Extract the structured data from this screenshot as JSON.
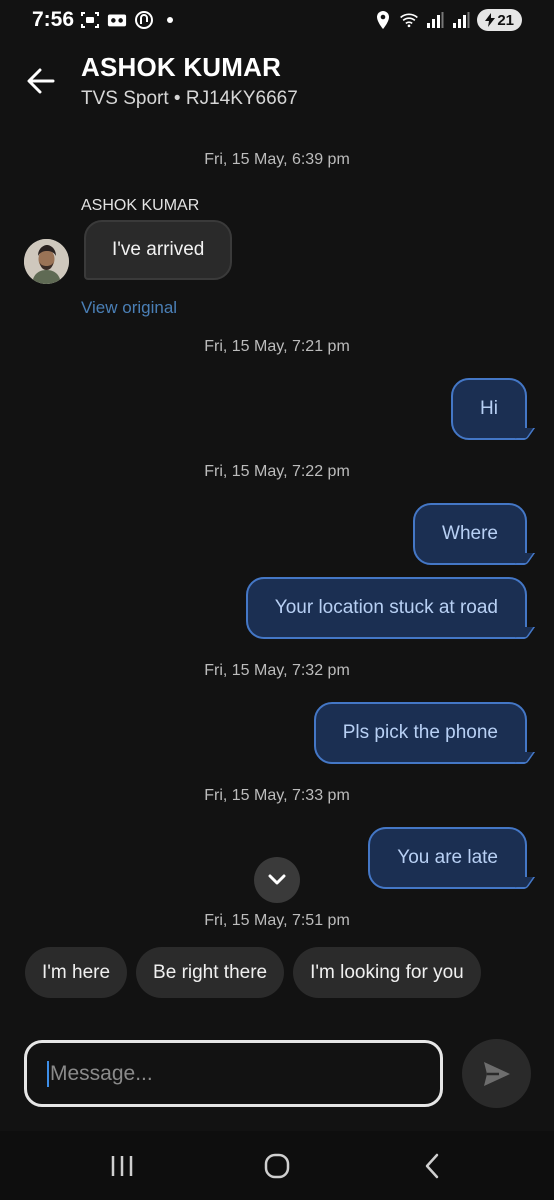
{
  "status_bar": {
    "time": "7:56",
    "battery": "21",
    "icons_left": [
      "screenshot-icon",
      "voicemail-icon",
      "app-icon",
      "dot-icon"
    ],
    "icons_right": [
      "location-icon",
      "wifi-icon",
      "signal-icon",
      "signal-icon",
      "battery-icon"
    ]
  },
  "header": {
    "name": "ASHOK KUMAR",
    "vehicle": "TVS Sport • RJ14KY6667"
  },
  "messages": [
    {
      "type": "stamp",
      "text": "Fri, 15 May, 6:39 pm"
    },
    {
      "type": "incoming",
      "sender": "ASHOK KUMAR",
      "text": "I've arrived",
      "link": "View original"
    },
    {
      "type": "stamp",
      "text": "Fri, 15 May, 7:21 pm"
    },
    {
      "type": "outgoing",
      "text": "Hi"
    },
    {
      "type": "stamp",
      "text": "Fri, 15 May, 7:22 pm"
    },
    {
      "type": "outgoing",
      "text": "Where"
    },
    {
      "type": "outgoing",
      "text": "Your location stuck at road"
    },
    {
      "type": "stamp",
      "text": "Fri, 15 May, 7:32 pm"
    },
    {
      "type": "outgoing",
      "text": "Pls pick the phone"
    },
    {
      "type": "stamp",
      "text": "Fri, 15 May, 7:33 pm"
    },
    {
      "type": "outgoing",
      "text": "You are late"
    },
    {
      "type": "stamp",
      "text": "Fri, 15 May, 7:51 pm"
    }
  ],
  "quick_replies": [
    "I'm here",
    "Be right there",
    "I'm looking for you"
  ],
  "composer": {
    "placeholder": "Message..."
  },
  "nav": [
    "recent-apps-icon",
    "home-icon",
    "back-icon"
  ],
  "colors": {
    "background": "#121212",
    "outgoing_bubble": "#1b2f52",
    "outgoing_border": "#4477c6",
    "outgoing_text": "#b8d0f4",
    "link": "#4a7fb6"
  }
}
